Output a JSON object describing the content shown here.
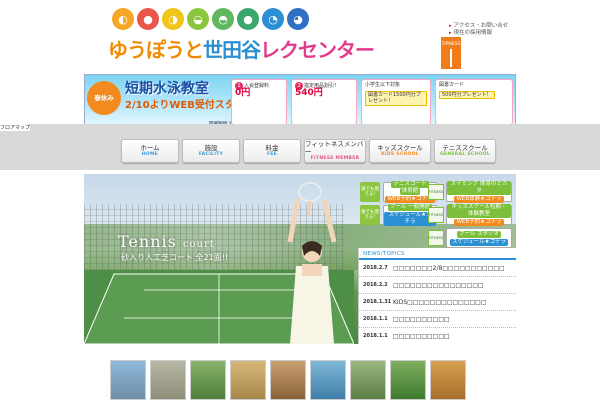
{
  "header": {
    "logo_part1": "ゆうぽうと",
    "logo_part2": "世田谷",
    "logo_part3": "レクセンター",
    "links": [
      "アクセス・お問い合せ",
      "現在の採用情報"
    ],
    "tipness_label": "TIPNESS"
  },
  "sports_icons": [
    {
      "name": "swimming-icon",
      "color": "#f5a623"
    },
    {
      "name": "soccer-icon",
      "color": "#e8574a"
    },
    {
      "name": "tennis-icon",
      "color": "#f0c419"
    },
    {
      "name": "baseball-icon",
      "color": "#8cc63f"
    },
    {
      "name": "volleyball-icon",
      "color": "#5fb85f"
    },
    {
      "name": "basketball-icon",
      "color": "#3aa76d"
    },
    {
      "name": "running-icon",
      "color": "#2a8fd3"
    },
    {
      "name": "golf-icon",
      "color": "#2f6fc4"
    }
  ],
  "promo": {
    "badge": "春休み",
    "headline": "短期水泳教室",
    "sub": "2/10よりWEB受付スタート！",
    "dates": "開催期間:3/11～3/31",
    "card1": {
      "num": "1",
      "text": "入会登録料",
      "price": "0円"
    },
    "card2": {
      "num": "2",
      "text": "指定用品割引！",
      "price": "540円"
    },
    "card3": {
      "text": "小学生以下対象",
      "box": "図書カード1500円分プレゼント！"
    },
    "card4": {
      "text": "図書カード",
      "box": "500円分プレゼント！"
    }
  },
  "band_label": "フロアマップ",
  "nav": [
    {
      "jp": "ホーム",
      "en": "HOME",
      "color": "#3a9ad9",
      "width": 58
    },
    {
      "jp": "施設",
      "en": "FACILITY",
      "color": "#3a9ad9",
      "width": 58
    },
    {
      "jp": "料金",
      "en": "FEE",
      "color": "#3a9ad9",
      "width": 58
    },
    {
      "jp": "フィットネスメンバー",
      "en": "FITNESS MEMBER",
      "color": "#e8577f",
      "width": 62
    },
    {
      "jp": "キッズスクール",
      "en": "KIDS SCHOOL",
      "color": "#f08a1f",
      "width": 62
    },
    {
      "jp": "テニススクール",
      "en": "GENERAL SCHOOL",
      "color": "#7bbf3a",
      "width": 62
    }
  ],
  "hero": {
    "title": "Tennis",
    "title_small": "court",
    "sub": "砂入り人工芝コート 全21面!!"
  },
  "quick_left": [
    {
      "label": "誰でも使える!",
      "top": "テニスコート",
      "mid": "体育館",
      "btn": "WEB予約★コチラ"
    },
    {
      "label": "誰でも使える!",
      "top": "プール 一般開放",
      "mid": "",
      "btn": "スケジュール★コチラ"
    }
  ],
  "quick_right": [
    {
      "logo": "FITNESS",
      "top": "スイミング 体育のミカタ",
      "btn": "WEB体験★コチラ"
    },
    {
      "logo": "FITNESS",
      "top": "キッズスクール短期・体験教室",
      "btn": "WEB予約★コチラ"
    },
    {
      "logo": "FITNESS",
      "top": "プール スタジオ",
      "btn": "スケジュール★コチラ"
    }
  ],
  "news": {
    "heading": "NEWS/TOPICS",
    "items": [
      {
        "date": "2018.2.7",
        "title": "□□□□□□□2/8□□□□□□□□□□□"
      },
      {
        "date": "2018.2.2",
        "title": "□□□□□□□□□□□□□□□□"
      },
      {
        "date": "2018.1.31",
        "title": "KIDS□□□□□□□□□□□□□□"
      },
      {
        "date": "2018.1.1",
        "title": "□□□□□□□□□□"
      },
      {
        "date": "2018.1.1",
        "title": "□□□□□□□□□□"
      }
    ]
  },
  "thumbs": [
    {
      "name": "thumb-building",
      "c1": "#8fb8d8",
      "c2": "#6f8fa8"
    },
    {
      "name": "thumb-parking",
      "c1": "#b7b7a5",
      "c2": "#8d8d78"
    },
    {
      "name": "thumb-trees",
      "c1": "#88b36a",
      "c2": "#4f7f3a"
    },
    {
      "name": "thumb-lobby",
      "c1": "#d8b77a",
      "c2": "#a8874a"
    },
    {
      "name": "thumb-room",
      "c1": "#c8a070",
      "c2": "#8a6238"
    },
    {
      "name": "thumb-pool",
      "c1": "#7fb7d8",
      "c2": "#3f7fa8"
    },
    {
      "name": "thumb-path",
      "c1": "#9ab87f",
      "c2": "#5c7f45"
    },
    {
      "name": "thumb-court",
      "c1": "#7fae5f",
      "c2": "#3e7a2c"
    },
    {
      "name": "thumb-gym",
      "c1": "#d8a050",
      "c2": "#a86f2a"
    }
  ]
}
